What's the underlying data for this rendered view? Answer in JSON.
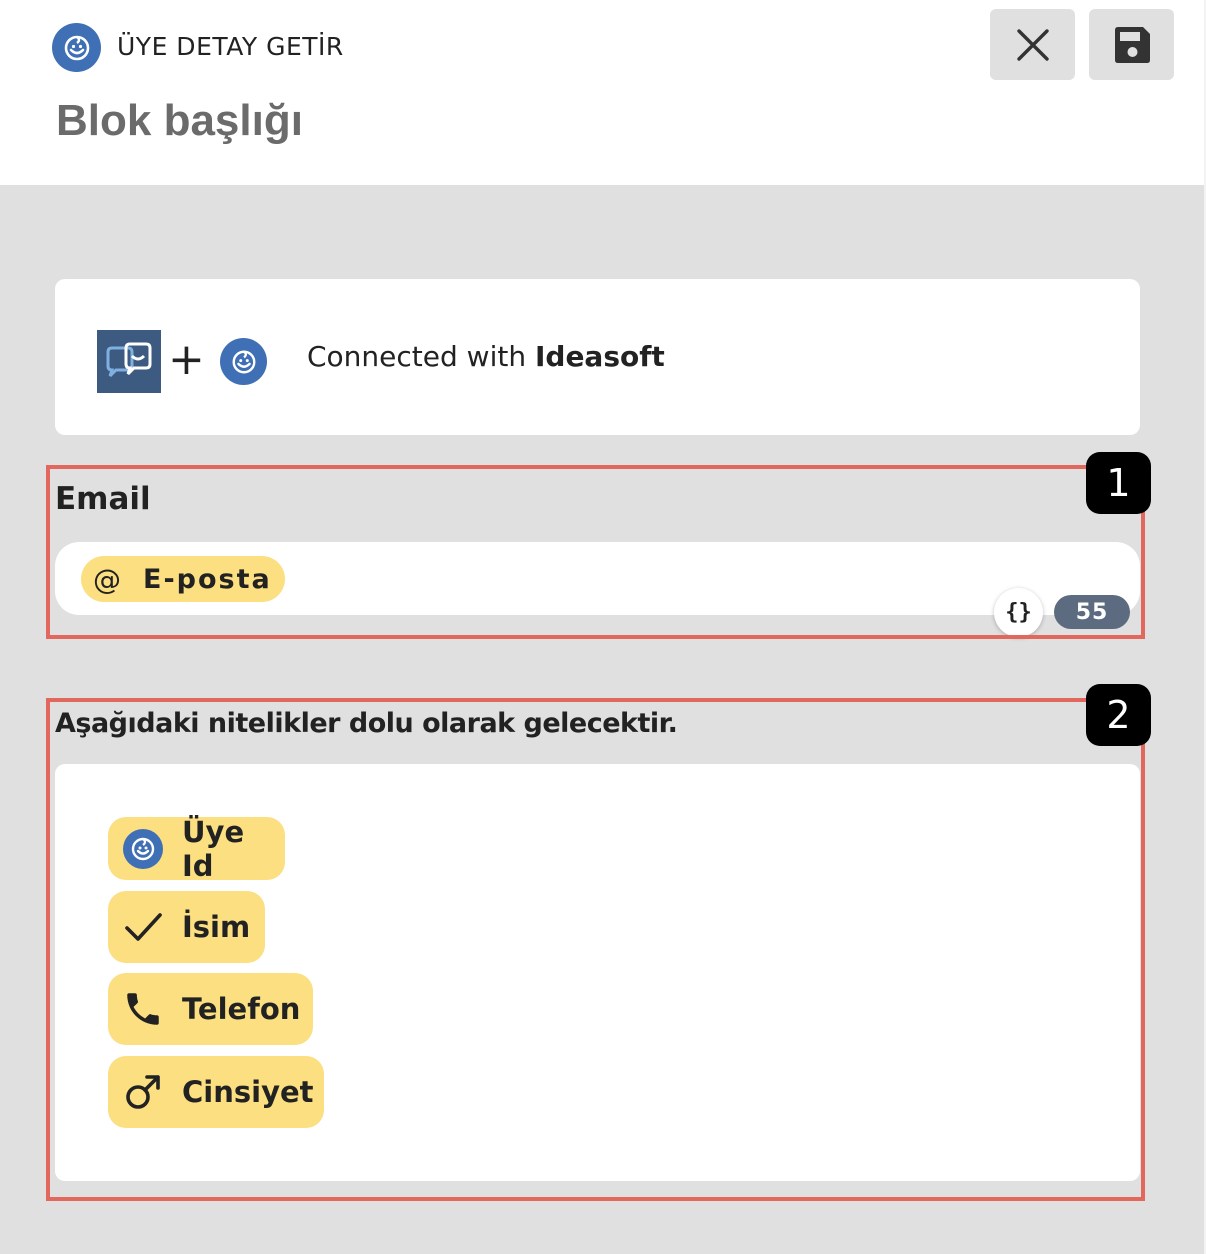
{
  "header": {
    "app_title": "ÜYE DETAY GETİR",
    "block_title": "Blok başlığı",
    "close_icon": "close-icon",
    "save_icon": "floppy-disk-icon"
  },
  "connection": {
    "plus": "+",
    "text_prefix": "Connected with ",
    "partner_name": "Ideasoft"
  },
  "email_section": {
    "label": "Email",
    "tag_icon": "@",
    "tag_label": "E-posta",
    "variables_icon": "{}",
    "char_count": "55"
  },
  "attributes_section": {
    "label": "Aşağıdaki nitelikler dolu olarak gelecektir.",
    "items": [
      {
        "label": "Üye Id",
        "icon": "ideasoft-logo-icon"
      },
      {
        "label": "İsim",
        "icon": "check-icon"
      },
      {
        "label": "Telefon",
        "icon": "phone-icon"
      },
      {
        "label": "Cinsiyet",
        "icon": "male-icon"
      }
    ]
  },
  "annotations": {
    "badge_1": "1",
    "badge_2": "2"
  },
  "colors": {
    "brand_blue": "#3f6fb4",
    "tag_yellow": "#fbdf80",
    "annotation_red": "#e2685d",
    "panel_gray": "#e0e0e0",
    "count_badge": "#5d6b80"
  }
}
